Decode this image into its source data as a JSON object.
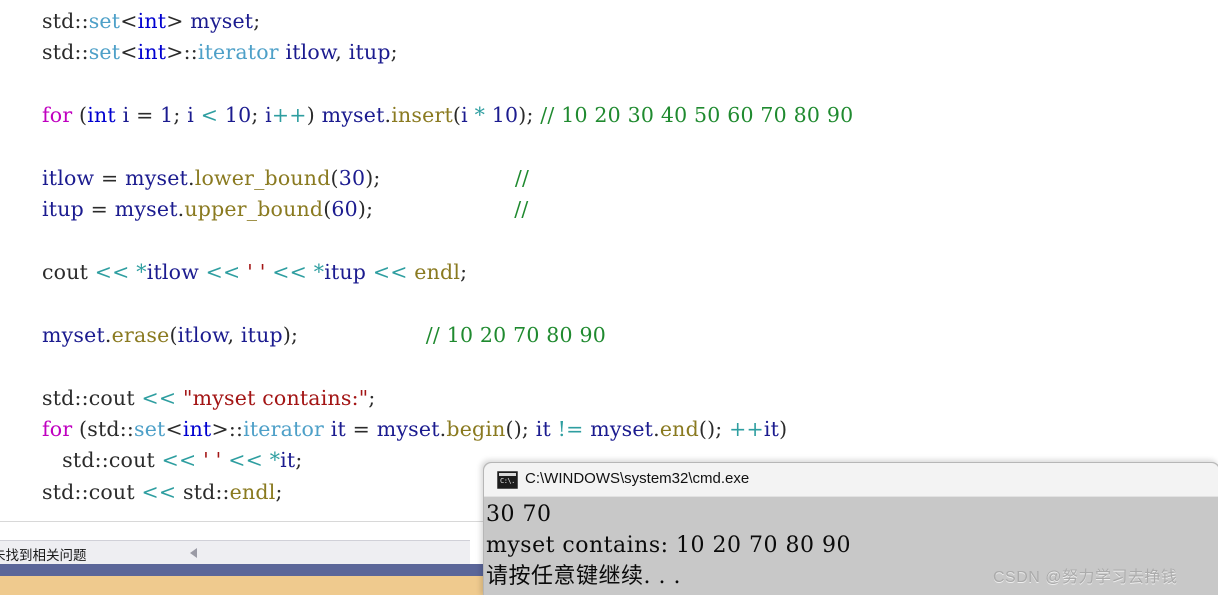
{
  "editor": {
    "name": "code-editor",
    "language": "cpp",
    "lines": [
      {
        "indent": 0,
        "tokens": [
          {
            "t": "std",
            "c": "plain"
          },
          {
            "t": "::",
            "c": "punct"
          },
          {
            "t": "set",
            "c": "class"
          },
          {
            "t": "<",
            "c": "punct"
          },
          {
            "t": "int",
            "c": "type"
          },
          {
            "t": ">",
            "c": "punct"
          },
          {
            "t": " myset",
            "c": "id"
          },
          {
            "t": ";",
            "c": "punct"
          }
        ]
      },
      {
        "indent": 0,
        "tokens": [
          {
            "t": "std",
            "c": "plain"
          },
          {
            "t": "::",
            "c": "punct"
          },
          {
            "t": "set",
            "c": "class"
          },
          {
            "t": "<",
            "c": "punct"
          },
          {
            "t": "int",
            "c": "type"
          },
          {
            "t": ">",
            "c": "punct"
          },
          {
            "t": "::",
            "c": "punct"
          },
          {
            "t": "iterator",
            "c": "class"
          },
          {
            "t": " itlow",
            "c": "id"
          },
          {
            "t": ",",
            "c": "punct"
          },
          {
            "t": " itup",
            "c": "id"
          },
          {
            "t": ";",
            "c": "punct"
          }
        ]
      },
      {
        "indent": 0,
        "tokens": []
      },
      {
        "indent": 0,
        "tokens": [
          {
            "t": "for",
            "c": "kw"
          },
          {
            "t": " (",
            "c": "punct"
          },
          {
            "t": "int",
            "c": "type"
          },
          {
            "t": " i",
            "c": "id"
          },
          {
            "t": " = ",
            "c": "punct"
          },
          {
            "t": "1",
            "c": "num"
          },
          {
            "t": "; ",
            "c": "punct"
          },
          {
            "t": "i",
            "c": "id"
          },
          {
            "t": " < ",
            "c": "op"
          },
          {
            "t": "10",
            "c": "num"
          },
          {
            "t": "; ",
            "c": "punct"
          },
          {
            "t": "i",
            "c": "id"
          },
          {
            "t": "++",
            "c": "op"
          },
          {
            "t": ") ",
            "c": "punct"
          },
          {
            "t": "myset",
            "c": "id"
          },
          {
            "t": ".",
            "c": "punct"
          },
          {
            "t": "insert",
            "c": "func"
          },
          {
            "t": "(",
            "c": "punct"
          },
          {
            "t": "i",
            "c": "id"
          },
          {
            "t": " * ",
            "c": "op"
          },
          {
            "t": "10",
            "c": "num"
          },
          {
            "t": "); ",
            "c": "punct"
          },
          {
            "t": "// 10 20 30 40 50 60 70 80 90",
            "c": "comment"
          }
        ]
      },
      {
        "indent": 0,
        "tokens": []
      },
      {
        "indent": 0,
        "tokens": [
          {
            "t": "itlow",
            "c": "id"
          },
          {
            "t": " = ",
            "c": "punct"
          },
          {
            "t": "myset",
            "c": "id"
          },
          {
            "t": ".",
            "c": "punct"
          },
          {
            "t": "lower_bound",
            "c": "func"
          },
          {
            "t": "(",
            "c": "punct"
          },
          {
            "t": "30",
            "c": "num"
          },
          {
            "t": ");",
            "c": "punct"
          },
          {
            "t": "                    ",
            "c": "plain"
          },
          {
            "t": "//",
            "c": "comment"
          }
        ]
      },
      {
        "indent": 0,
        "tokens": [
          {
            "t": "itup",
            "c": "id"
          },
          {
            "t": " = ",
            "c": "punct"
          },
          {
            "t": "myset",
            "c": "id"
          },
          {
            "t": ".",
            "c": "punct"
          },
          {
            "t": "upper_bound",
            "c": "func"
          },
          {
            "t": "(",
            "c": "punct"
          },
          {
            "t": "60",
            "c": "num"
          },
          {
            "t": ");",
            "c": "punct"
          },
          {
            "t": "                     ",
            "c": "plain"
          },
          {
            "t": "//",
            "c": "comment"
          }
        ]
      },
      {
        "indent": 0,
        "tokens": []
      },
      {
        "indent": 0,
        "tokens": [
          {
            "t": "cout",
            "c": "plain"
          },
          {
            "t": " << ",
            "c": "op"
          },
          {
            "t": "*",
            "c": "op"
          },
          {
            "t": "itlow",
            "c": "id"
          },
          {
            "t": " << ",
            "c": "op"
          },
          {
            "t": "' '",
            "c": "str"
          },
          {
            "t": " << ",
            "c": "op"
          },
          {
            "t": "*",
            "c": "op"
          },
          {
            "t": "itup",
            "c": "id"
          },
          {
            "t": " << ",
            "c": "op"
          },
          {
            "t": "endl",
            "c": "func"
          },
          {
            "t": ";",
            "c": "punct"
          }
        ]
      },
      {
        "indent": 0,
        "tokens": []
      },
      {
        "indent": 0,
        "tokens": [
          {
            "t": "myset",
            "c": "id"
          },
          {
            "t": ".",
            "c": "punct"
          },
          {
            "t": "erase",
            "c": "func"
          },
          {
            "t": "(",
            "c": "punct"
          },
          {
            "t": "itlow",
            "c": "id"
          },
          {
            "t": ", ",
            "c": "punct"
          },
          {
            "t": "itup",
            "c": "id"
          },
          {
            "t": ");",
            "c": "punct"
          },
          {
            "t": "                   ",
            "c": "plain"
          },
          {
            "t": "// 10 20 70 80 90",
            "c": "comment"
          }
        ]
      },
      {
        "indent": 0,
        "tokens": []
      },
      {
        "indent": 0,
        "tokens": [
          {
            "t": "std",
            "c": "plain"
          },
          {
            "t": "::",
            "c": "punct"
          },
          {
            "t": "cout",
            "c": "plain"
          },
          {
            "t": " << ",
            "c": "op"
          },
          {
            "t": "\"myset contains:\"",
            "c": "str"
          },
          {
            "t": ";",
            "c": "punct"
          }
        ]
      },
      {
        "indent": 0,
        "tokens": [
          {
            "t": "for",
            "c": "kw"
          },
          {
            "t": " (",
            "c": "punct"
          },
          {
            "t": "std",
            "c": "plain"
          },
          {
            "t": "::",
            "c": "punct"
          },
          {
            "t": "set",
            "c": "class"
          },
          {
            "t": "<",
            "c": "punct"
          },
          {
            "t": "int",
            "c": "type"
          },
          {
            "t": ">",
            "c": "punct"
          },
          {
            "t": "::",
            "c": "punct"
          },
          {
            "t": "iterator",
            "c": "class"
          },
          {
            "t": " it",
            "c": "id"
          },
          {
            "t": " = ",
            "c": "punct"
          },
          {
            "t": "myset",
            "c": "id"
          },
          {
            "t": ".",
            "c": "punct"
          },
          {
            "t": "begin",
            "c": "func"
          },
          {
            "t": "(); ",
            "c": "punct"
          },
          {
            "t": "it",
            "c": "id"
          },
          {
            "t": " != ",
            "c": "op"
          },
          {
            "t": "myset",
            "c": "id"
          },
          {
            "t": ".",
            "c": "punct"
          },
          {
            "t": "end",
            "c": "func"
          },
          {
            "t": "(); ",
            "c": "punct"
          },
          {
            "t": "++",
            "c": "op"
          },
          {
            "t": "it",
            "c": "id"
          },
          {
            "t": ")",
            "c": "punct"
          }
        ]
      },
      {
        "indent": 3,
        "tokens": [
          {
            "t": "std",
            "c": "plain"
          },
          {
            "t": "::",
            "c": "punct"
          },
          {
            "t": "cout",
            "c": "plain"
          },
          {
            "t": " << ",
            "c": "op"
          },
          {
            "t": "' '",
            "c": "str"
          },
          {
            "t": " << ",
            "c": "op"
          },
          {
            "t": "*",
            "c": "op"
          },
          {
            "t": "it",
            "c": "id"
          },
          {
            "t": ";",
            "c": "punct"
          }
        ]
      },
      {
        "indent": 0,
        "tokens": [
          {
            "t": "std",
            "c": "plain"
          },
          {
            "t": "::",
            "c": "punct"
          },
          {
            "t": "cout",
            "c": "plain"
          },
          {
            "t": " << ",
            "c": "op"
          },
          {
            "t": "std",
            "c": "plain"
          },
          {
            "t": "::",
            "c": "punct"
          },
          {
            "t": "endl",
            "c": "func"
          },
          {
            "t": ";",
            "c": "punct"
          }
        ]
      }
    ]
  },
  "error_list": {
    "label": "未找到相关问题",
    "collapse_arrow": "left-triangle"
  },
  "console": {
    "title": "C:\\WINDOWS\\system32\\cmd.exe",
    "icon": "cmd-icon",
    "icon_glyph": "C:\\.",
    "output_lines": [
      "30 70",
      "myset contains: 10 20 70 80 90",
      "请按任意键继续. . ."
    ]
  },
  "watermark": {
    "text": "CSDN @努力学习去挣钱"
  },
  "colors": {
    "keyword": "#c000c0",
    "type": "#0000d0",
    "class": "#4ea0c8",
    "function": "#8a7a20",
    "operator": "#2e9ea0",
    "string": "#a31515",
    "comment": "#1f8a2f",
    "identifier": "#1b1b8f",
    "console_bg": "#c8c8c8",
    "bar_blue": "#5b6699",
    "bar_tan": "#efca8e"
  }
}
